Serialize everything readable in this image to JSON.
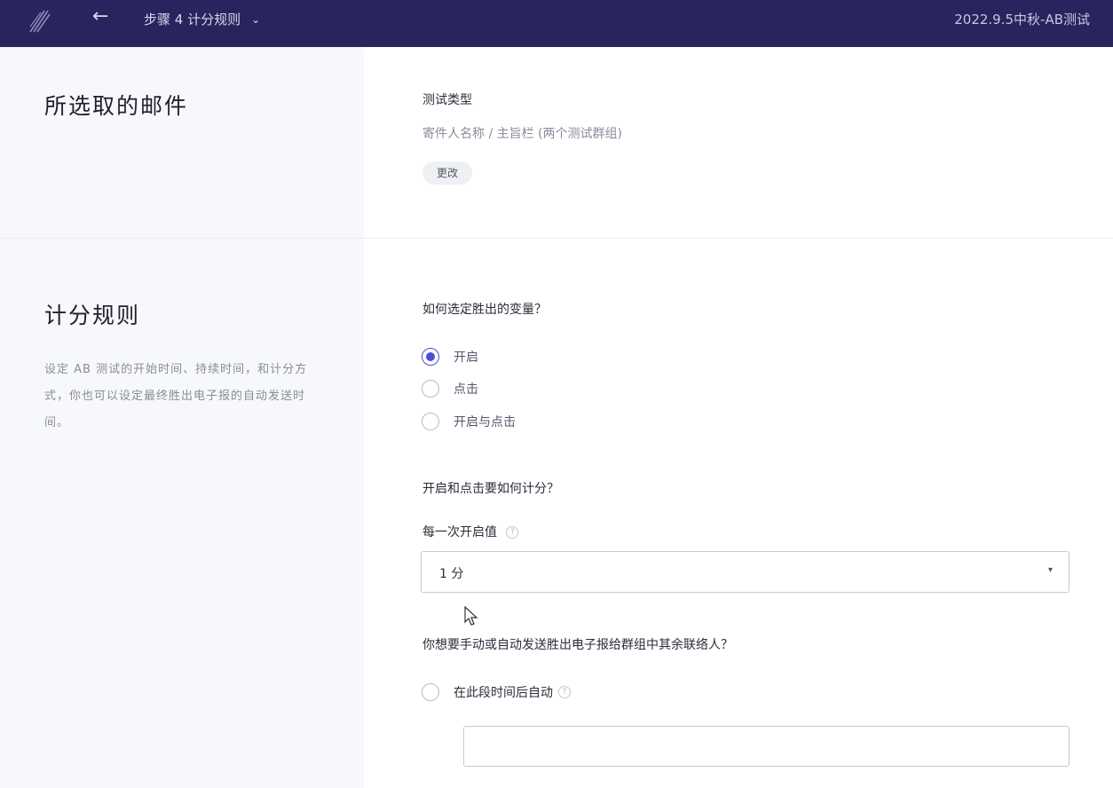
{
  "header": {
    "back_icon": "←",
    "step_label": "步骤 4  计分规则",
    "step_chevron": "⌄",
    "campaign_name": "2022.9.5中秋-AB测试"
  },
  "selected_email": {
    "title": "所选取的邮件",
    "test_type_label": "测试类型",
    "test_type_value": "寄件人名称 / 主旨栏 (两个测试群组)",
    "edit_button": "更改"
  },
  "scoring": {
    "title": "计分规则",
    "description": "设定 AB 测试的开始时间、持续时间，和计分方式，你也可以设定最终胜出电子报的自动发送时间。",
    "question_winner": "如何选定胜出的变量？",
    "options": [
      {
        "label": "开启",
        "checked": true
      },
      {
        "label": "点击",
        "checked": false
      },
      {
        "label": "开启与点击",
        "checked": false
      }
    ],
    "question_score": "开启和点击要如何计分？",
    "per_open_label": "每一次开启值",
    "per_open_value": "1 分",
    "question_send": "你想要手动或自动发送胜出电子报给群组中其余联络人？",
    "auto_option": "在此段时间后自动",
    "help_icon": "?",
    "caret_icon": "▾"
  },
  "colors": {
    "topbar": "#27245e",
    "accent": "#4a4ed6",
    "left_panel": "#f7f8fb"
  }
}
